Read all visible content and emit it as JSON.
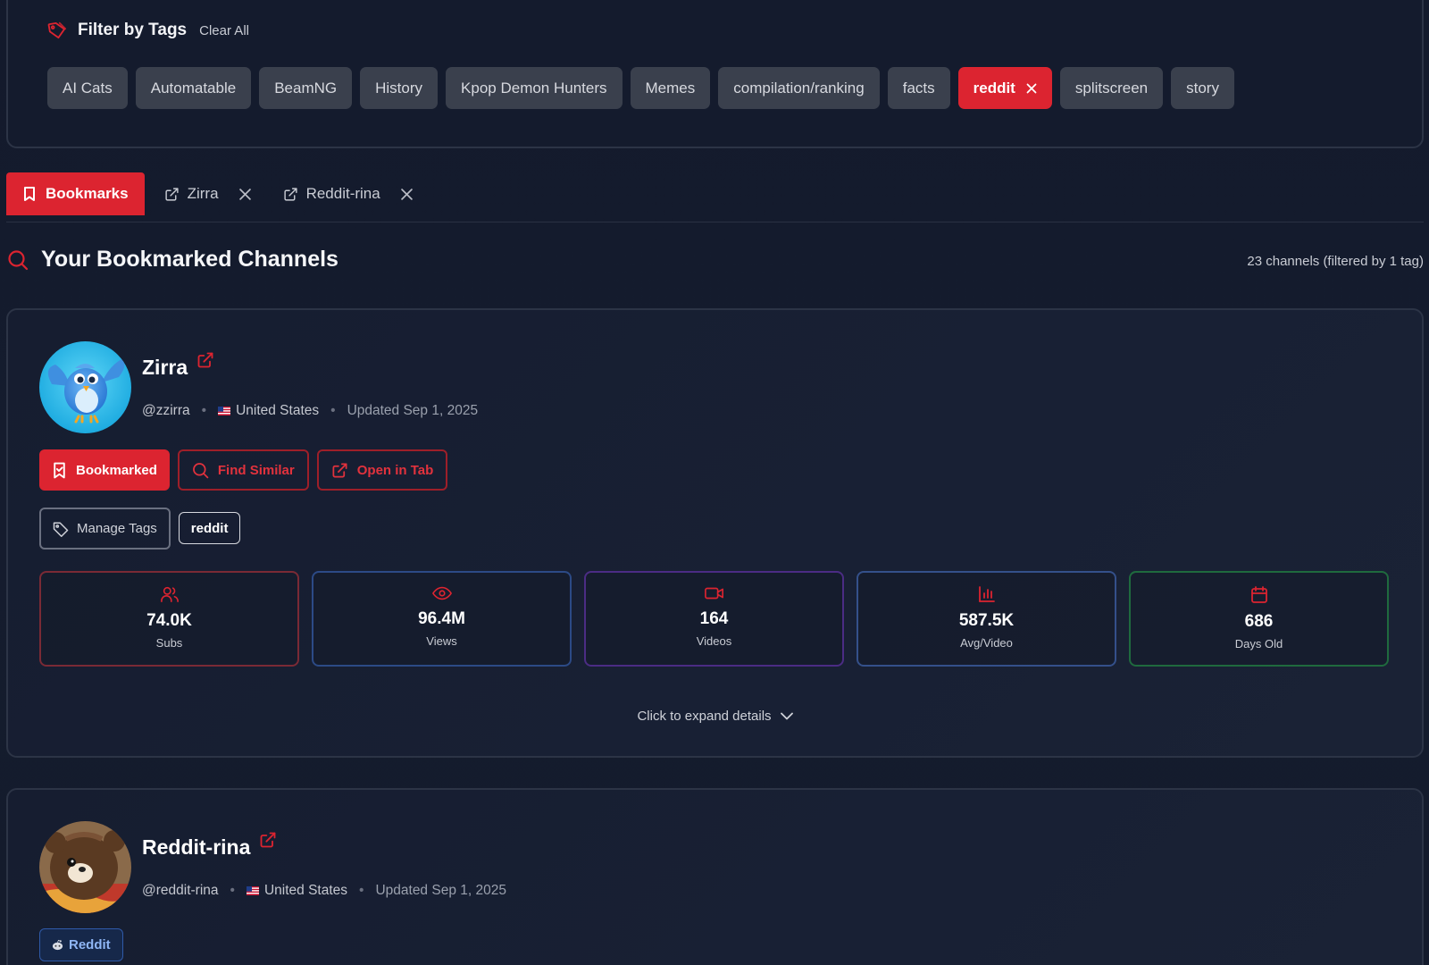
{
  "filter": {
    "title": "Filter by Tags",
    "clear_all": "Clear All",
    "tags": [
      {
        "label": "AI Cats",
        "active": false
      },
      {
        "label": "Automatable",
        "active": false
      },
      {
        "label": "BeamNG",
        "active": false
      },
      {
        "label": "History",
        "active": false
      },
      {
        "label": "Kpop Demon Hunters",
        "active": false
      },
      {
        "label": "Memes",
        "active": false
      },
      {
        "label": "compilation/ranking",
        "active": false
      },
      {
        "label": "facts",
        "active": false
      },
      {
        "label": "reddit",
        "active": true
      },
      {
        "label": "splitscreen",
        "active": false
      },
      {
        "label": "story",
        "active": false
      }
    ]
  },
  "tabs": {
    "active": {
      "label": "Bookmarks",
      "icon": "bookmark-icon"
    },
    "items": [
      {
        "label": "Zirra",
        "icon": "external-link-icon"
      },
      {
        "label": "Reddit-rina",
        "icon": "external-link-icon"
      }
    ]
  },
  "section": {
    "title": "Your Bookmarked Channels",
    "count_text": "23 channels (filtered by 1 tag)"
  },
  "channels": [
    {
      "name": "Zirra",
      "handle": "@zzirra",
      "country": "United States",
      "updated": "Updated Sep 1, 2025",
      "buttons": {
        "bookmarked": "Bookmarked",
        "find_similar": "Find Similar",
        "open_in_tab": "Open in Tab"
      },
      "manage_tags": "Manage Tags",
      "tags": [
        "reddit"
      ],
      "stats": [
        {
          "value": "74.0K",
          "label": "Subs",
          "icon": "users-icon",
          "color": "#7a2a35"
        },
        {
          "value": "96.4M",
          "label": "Views",
          "icon": "eye-icon",
          "color": "#2c4a86"
        },
        {
          "value": "164",
          "label": "Videos",
          "icon": "video-icon",
          "color": "#4b2c84"
        },
        {
          "value": "587.5K",
          "label": "Avg/Video",
          "icon": "bar-chart-icon",
          "color": "#34508a"
        },
        {
          "value": "686",
          "label": "Days Old",
          "icon": "calendar-icon",
          "color": "#1f6a3e"
        }
      ],
      "expand_text": "Click to expand details"
    },
    {
      "name": "Reddit-rina",
      "handle": "@reddit-rina",
      "country": "United States",
      "updated": "Updated Sep 1, 2025",
      "platform_badge": "Reddit"
    }
  ],
  "colors": {
    "accent": "#dc2430",
    "background": "#141b2d",
    "chip": "#3a404d"
  }
}
